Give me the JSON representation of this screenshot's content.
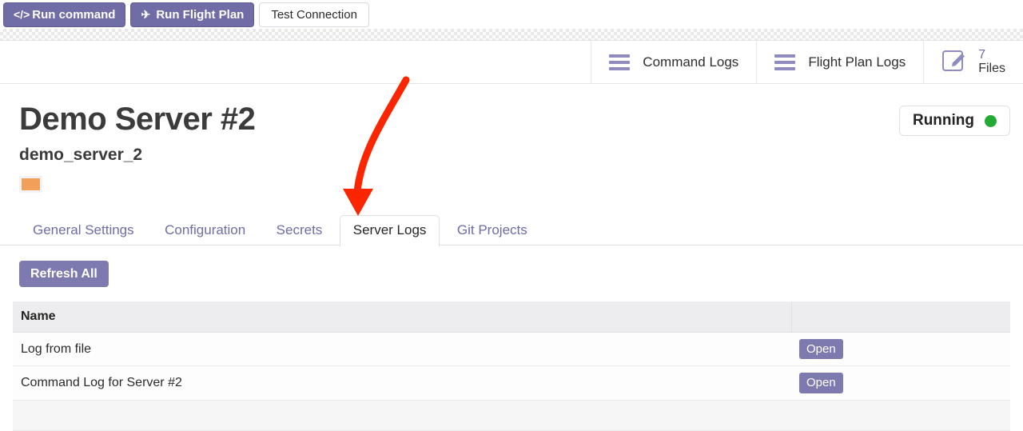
{
  "toolbar": {
    "run_command": {
      "label": "Run command",
      "glyph": "</>",
      "icon": "code-icon"
    },
    "run_flight_plan": {
      "label": "Run Flight Plan",
      "glyph": "✈",
      "icon": "plane-icon"
    },
    "test_connection": {
      "label": "Test Connection"
    }
  },
  "header": {
    "command_logs": {
      "label": "Command Logs",
      "icon": "hamburger-icon"
    },
    "flight_plan_logs": {
      "label": "Flight Plan Logs",
      "icon": "hamburger-icon"
    },
    "files": {
      "count": "7",
      "label": "Files",
      "icon": "edit-file-icon"
    }
  },
  "page": {
    "title": "Demo Server #2",
    "subtitle": "demo_server_2",
    "swatch_color": "#f0a059",
    "status": {
      "text": "Running",
      "dot_color": "#22aa33"
    }
  },
  "tabs": [
    {
      "label": "General Settings",
      "active": false
    },
    {
      "label": "Configuration",
      "active": false
    },
    {
      "label": "Secrets",
      "active": false
    },
    {
      "label": "Server Logs",
      "active": true
    },
    {
      "label": "Git Projects",
      "active": false
    }
  ],
  "actions": {
    "refresh_all": "Refresh All"
  },
  "table": {
    "columns": [
      "Name",
      ""
    ],
    "rows": [
      {
        "name": "Log from file",
        "action": "Open"
      },
      {
        "name": "Command Log for Server #2",
        "action": "Open"
      }
    ]
  },
  "annotation": {
    "arrow_color": "#fb2600"
  }
}
